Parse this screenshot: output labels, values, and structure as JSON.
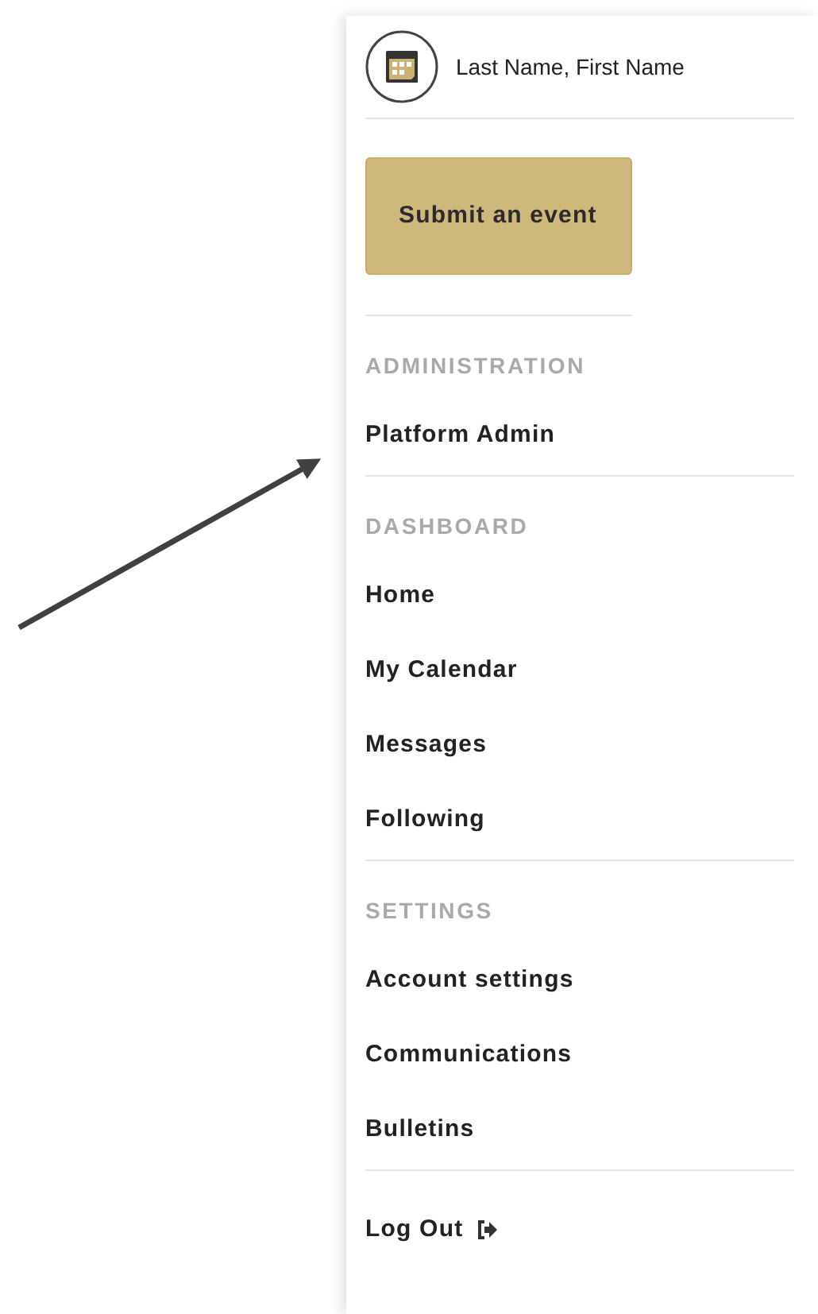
{
  "user": {
    "name": "Last Name, First Name"
  },
  "submit_button": {
    "label": "Submit an event"
  },
  "sections": [
    {
      "heading": "ADMINISTRATION",
      "items": [
        "Platform Admin"
      ]
    },
    {
      "heading": "DASHBOARD",
      "items": [
        "Home",
        "My Calendar",
        "Messages",
        "Following"
      ]
    },
    {
      "heading": "SETTINGS",
      "items": [
        "Account settings",
        "Communications",
        "Bulletins"
      ]
    }
  ],
  "logout": {
    "label": "Log Out"
  }
}
